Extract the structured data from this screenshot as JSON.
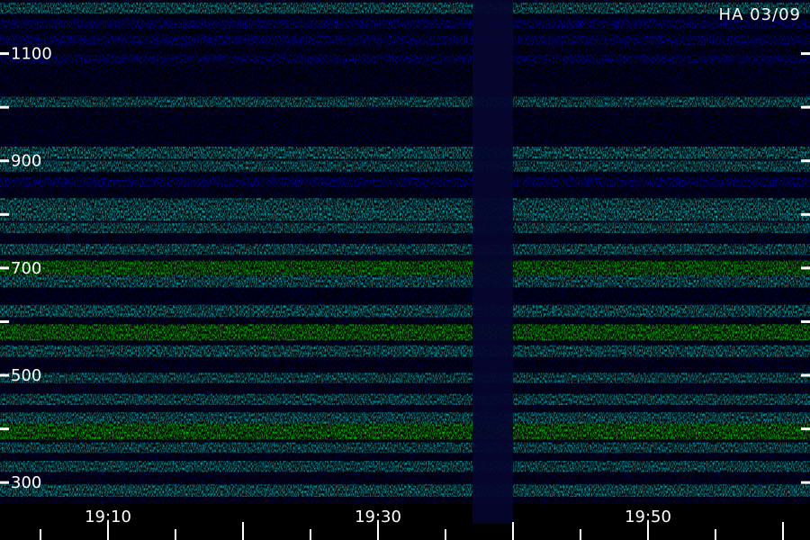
{
  "chart_data": {
    "type": "heatmap",
    "title": "",
    "overlay_label": "HA 03/09",
    "xlabel": "",
    "ylabel": "",
    "x_ticks": [
      "19:10",
      "19:30",
      "19:50"
    ],
    "y_ticks": [
      "1100",
      "900",
      "700",
      "500",
      "300"
    ],
    "x_range": [
      "19:02",
      "20:02"
    ],
    "y_range": [
      260,
      1200
    ],
    "grid": false,
    "colormap": [
      "#000000",
      "#0000ff",
      "#00ffff",
      "#00ff00",
      "#ffff00"
    ],
    "bands": [
      {
        "freq": 1185,
        "intensity": 0.45
      },
      {
        "freq": 1155,
        "intensity": 0.3
      },
      {
        "freq": 1125,
        "intensity": 0.35
      },
      {
        "freq": 1090,
        "intensity": 0.25
      },
      {
        "freq": 1010,
        "intensity": 0.4
      },
      {
        "freq": 915,
        "intensity": 0.55
      },
      {
        "freq": 890,
        "intensity": 0.45
      },
      {
        "freq": 860,
        "intensity": 0.35
      },
      {
        "freq": 820,
        "intensity": 0.45
      },
      {
        "freq": 800,
        "intensity": 0.6
      },
      {
        "freq": 775,
        "intensity": 0.4
      },
      {
        "freq": 735,
        "intensity": 0.45
      },
      {
        "freq": 700,
        "intensity": 0.75
      },
      {
        "freq": 675,
        "intensity": 0.5
      },
      {
        "freq": 620,
        "intensity": 0.55
      },
      {
        "freq": 580,
        "intensity": 0.85
      },
      {
        "freq": 545,
        "intensity": 0.5
      },
      {
        "freq": 495,
        "intensity": 0.4
      },
      {
        "freq": 455,
        "intensity": 0.45
      },
      {
        "freq": 420,
        "intensity": 0.5
      },
      {
        "freq": 395,
        "intensity": 0.85
      },
      {
        "freq": 365,
        "intensity": 0.4
      },
      {
        "freq": 330,
        "intensity": 0.45
      },
      {
        "freq": 285,
        "intensity": 0.55
      }
    ],
    "gap_times": [
      "19:37",
      "19:40"
    ]
  }
}
